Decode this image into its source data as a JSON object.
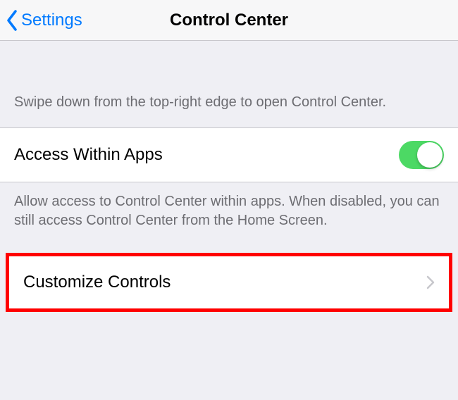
{
  "navbar": {
    "back_label": "Settings",
    "title": "Control Center"
  },
  "section1": {
    "description": "Swipe down from the top-right edge to open Control Center."
  },
  "access_within_apps": {
    "label": "Access Within Apps",
    "enabled": true,
    "footer": "Allow access to Control Center within apps. When disabled, you can still access Control Center from the Home Screen."
  },
  "customize": {
    "label": "Customize Controls"
  }
}
